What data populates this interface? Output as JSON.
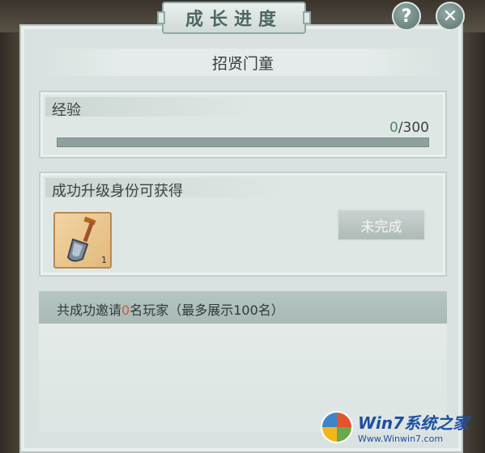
{
  "window": {
    "title": "成长进度",
    "help_label": "?",
    "close_label": "✕"
  },
  "subtitle": "招贤门童",
  "experience": {
    "label": "经验",
    "current": "0",
    "separator": "/",
    "max": "300",
    "progress_fraction": 0
  },
  "reward": {
    "label": "成功升级身份可获得",
    "item": {
      "icon": "shovel-icon",
      "quantity": "1"
    },
    "status_button": "未完成"
  },
  "invite": {
    "prefix": "共成功邀请",
    "count": "0",
    "suffix": "名玩家（最多展示100名）"
  },
  "watermark": {
    "title": "Win7系统之家",
    "url": "Www.Winwin7.com"
  }
}
